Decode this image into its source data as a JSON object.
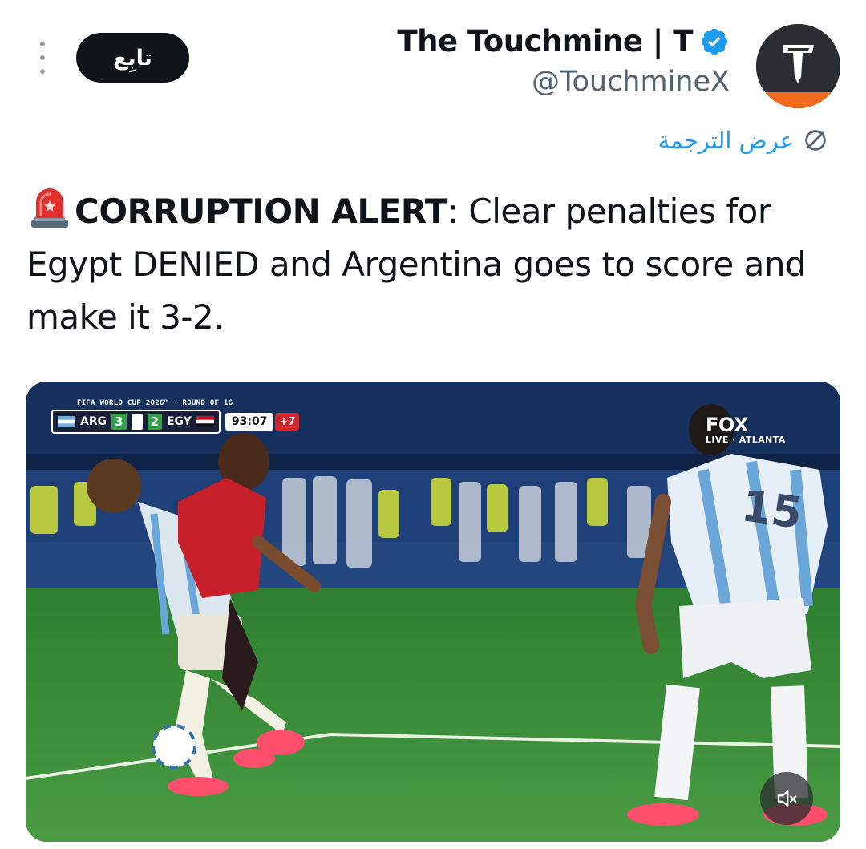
{
  "header": {
    "follow_label": "تابِع",
    "account_name": "The Touchmine | T",
    "account_handle": "@TouchmineX",
    "avatar_letter": "T"
  },
  "translate": {
    "label": "عرض الترجمة"
  },
  "tweet": {
    "alert_bold": "CORRUPTION ALERT",
    "body": ": Clear penalties for Egypt DENIED and Argentina goes to score and make it 3-2."
  },
  "video": {
    "tournament": "FIFA WORLD CUP 2026™ · ROUND OF 16",
    "team_home": "ARG",
    "score_home": "3",
    "score_away": "2",
    "team_away": "EGY",
    "match_clock": "93:07",
    "added_time": "+7",
    "broadcaster_channel": "FOX",
    "broadcaster_sub": "LIVE · ATLANTA",
    "player_number": "15"
  },
  "colors": {
    "accent": "#1d9bf0",
    "text": "#0f1419",
    "secondary_text": "#536471",
    "follow_bg": "#0f1419",
    "pitch": "#3b8f3a",
    "avatar_stripe": "#f26a1b"
  }
}
